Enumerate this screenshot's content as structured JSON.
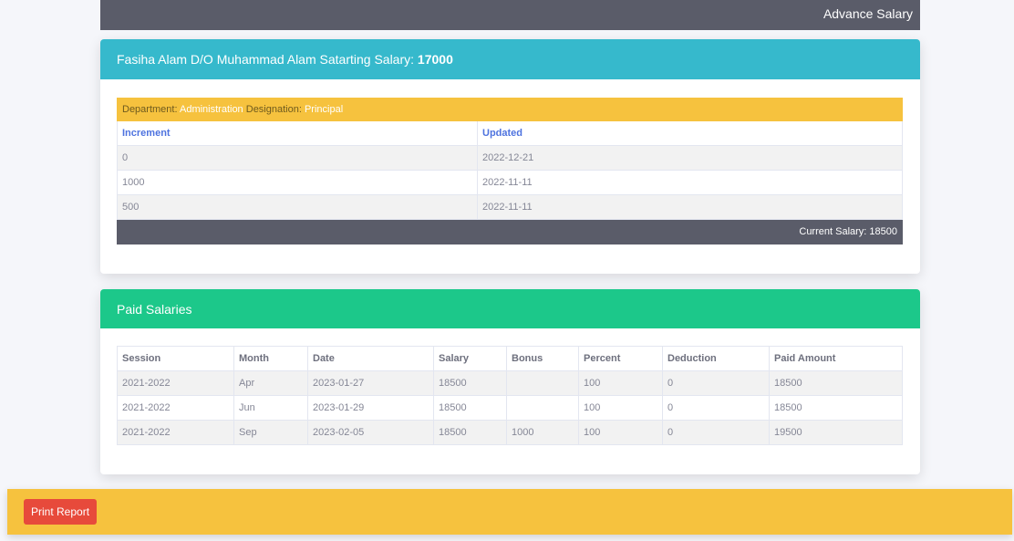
{
  "topbar": {
    "title": "Advance Salary"
  },
  "employee": {
    "heading": "Fasiha Alam D/O Muhammad Alam Satarting Salary:",
    "starting_salary": "17000",
    "department_label": "Department:",
    "department": "Administration",
    "designation_label": "Designation:",
    "designation": "Principal",
    "columns": [
      "Increment",
      "Updated"
    ],
    "rows": [
      [
        "0",
        "2022-12-21"
      ],
      [
        "1000",
        "2022-11-11"
      ],
      [
        "500",
        "2022-11-11"
      ]
    ],
    "current_salary": "Current Salary: 18500"
  },
  "paid": {
    "title": "Paid Salaries",
    "columns": [
      "Session",
      "Month",
      "Date",
      "Salary",
      "Bonus",
      "Percent",
      "Deduction",
      "Paid Amount"
    ],
    "rows": [
      [
        "2021-2022",
        "Apr",
        "2023-01-27",
        "18500",
        "",
        "100",
        "0",
        "18500"
      ],
      [
        "2021-2022",
        "Jun",
        "2023-01-29",
        "18500",
        "",
        "100",
        "0",
        "18500"
      ],
      [
        "2021-2022",
        "Sep",
        "2023-02-05",
        "18500",
        "1000",
        "100",
        "0",
        "19500"
      ]
    ]
  },
  "footer": {
    "print_label": "Print Report"
  }
}
